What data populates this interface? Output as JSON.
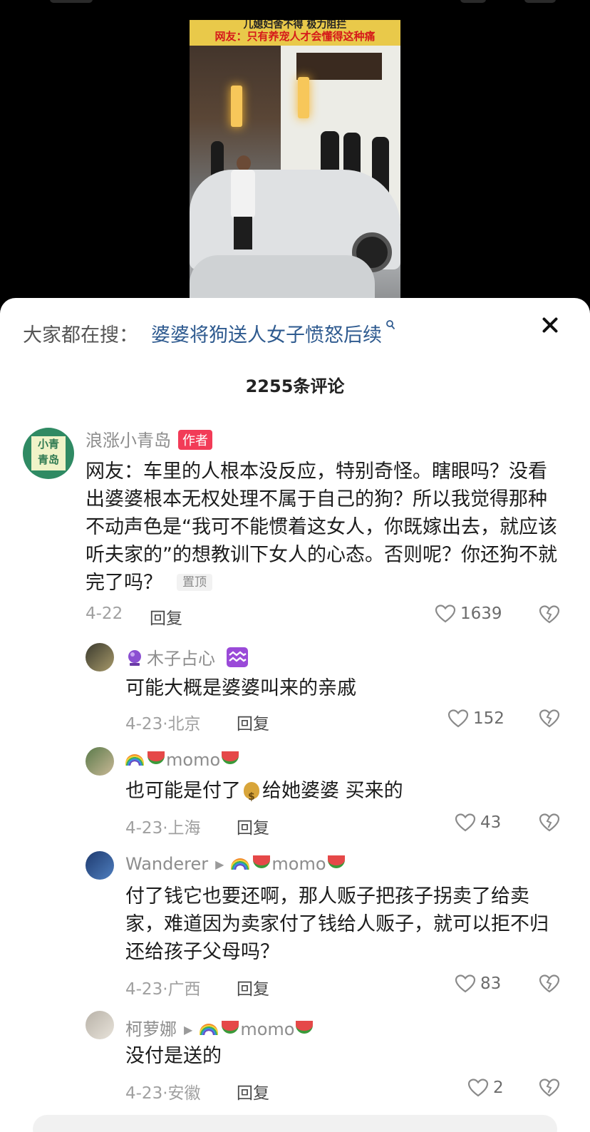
{
  "video": {
    "caption_line1": "儿媳妇舍不得 极力阻拦",
    "caption_line2": "网友：只有养宠人才会懂得这种痛"
  },
  "search_bar": {
    "label": "大家都在搜：",
    "query": "婆婆将狗送人女子愤怒后续"
  },
  "comments_header": {
    "count_text": "2255条评论"
  },
  "main_comment": {
    "avatar_text": "小青\n青岛",
    "username": "浪涨小青岛",
    "author_badge": "作者",
    "text": "网友：车里的人根本没反应，特别奇怪。瞎眼吗？没看出婆婆根本无权处理不属于自己的狗？所以我觉得那种不动声色是“我可不能惯着这女人，你既嫁出去，就应该听夫家的”的想教训下女人的心态。否则呢？你还狗不就完了吗？",
    "pin_badge": "置顶",
    "date": "4-22",
    "reply_label": "回复",
    "likes": "1639"
  },
  "replies": [
    {
      "username": "木子占心",
      "text": "可能大概是婆婆叫来的亲戚",
      "meta": "4-23·北京",
      "reply_label": "回复",
      "likes": "152"
    },
    {
      "username": "momo",
      "text_before": "也可能是付了",
      "text_after": "给她婆婆 买来的",
      "meta": "4-23·上海",
      "reply_label": "回复",
      "likes": "43"
    },
    {
      "username": "Wanderer",
      "reply_to": "momo",
      "text": "付了钱它也要还啊，那人贩子把孩子拐卖了给卖家，难道因为卖家付了钱给人贩子，就可以拒不归还给孩子父母吗？",
      "meta": "4-23·广西",
      "reply_label": "回复",
      "likes": "83"
    },
    {
      "username": "柯萝娜",
      "reply_to": "momo",
      "text": "没付是送的",
      "meta": "4-23·安徽",
      "reply_label": "回复",
      "likes": "2"
    }
  ],
  "icons": {
    "close": "close-icon",
    "like": "heart-outline-icon",
    "dislike": "broken-heart-icon",
    "search": "search-icon"
  },
  "colors": {
    "link": "#2e5a8f",
    "author_badge": "#f23b57",
    "panel_bg": "#ffffff",
    "video_bg": "#000000"
  }
}
